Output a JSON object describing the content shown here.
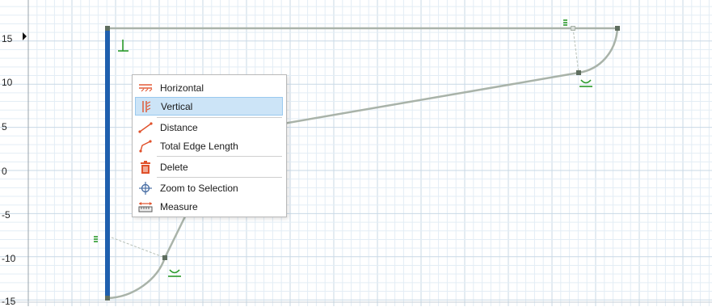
{
  "colors": {
    "grid_minor": "#e3edf5",
    "grid_major": "#c9d9e6",
    "selected_edge": "#1f5fae",
    "geometry": "#a9b3a9",
    "constraint": "#2a9a2a",
    "vertex": "#5f6e5f",
    "menu_selected": "#cce4f7",
    "icon_orange": "#e0502a"
  },
  "axis": {
    "y_ticks": [
      "15",
      "10",
      "5",
      "0",
      "-5",
      "-10",
      "-15"
    ]
  },
  "context_menu": {
    "items": [
      {
        "label": "Horizontal",
        "icon": "horizontal-constraint-icon"
      },
      {
        "label": "Vertical",
        "icon": "vertical-constraint-icon",
        "selected": true
      },
      {
        "label": "Distance",
        "icon": "distance-icon"
      },
      {
        "label": "Total Edge Length",
        "icon": "total-edge-length-icon"
      },
      {
        "label": "Delete",
        "icon": "delete-icon"
      },
      {
        "label": "Zoom to Selection",
        "icon": "zoom-to-selection-icon"
      },
      {
        "label": "Measure",
        "icon": "measure-icon"
      }
    ]
  }
}
